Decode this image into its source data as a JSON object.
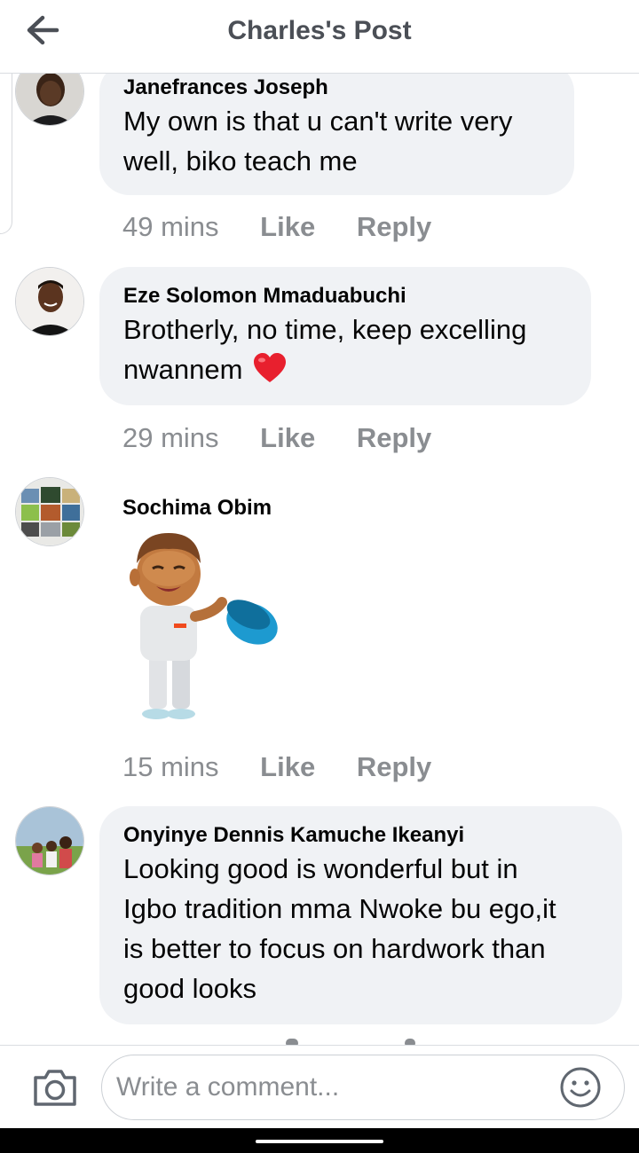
{
  "header": {
    "title": "Charles's Post"
  },
  "comments": [
    {
      "author": "Janefrances Joseph",
      "lines": [
        "My own is that u can't write very",
        "well, biko teach me"
      ],
      "time": "49 mins",
      "like": "Like",
      "reply": "Reply"
    },
    {
      "author": "Eze Solomon Mmaduabuchi",
      "lines": [
        "Brotherly,  no time, keep excelling",
        "nwannem"
      ],
      "time": "29 mins",
      "like": "Like",
      "reply": "Reply"
    },
    {
      "author": "Sochima Obim",
      "time": "15 mins",
      "like": "Like",
      "reply": "Reply"
    },
    {
      "author": "Onyinye Dennis Kamuche Ikeanyi",
      "lines": [
        "Looking good is wonderful but in",
        "Igbo tradition mma Nwoke bu ego,it",
        "is better to focus on hardwork than",
        "good looks"
      ]
    }
  ],
  "composer": {
    "placeholder": "Write a comment..."
  },
  "icons": {
    "back": "arrow-left-icon",
    "heart": "red-heart-emoji",
    "camera": "camera-icon",
    "emoji": "smiley-icon"
  },
  "colors": {
    "bubble": "#f0f2f5",
    "muted": "#8a8d91",
    "heart": "#e8202e"
  }
}
